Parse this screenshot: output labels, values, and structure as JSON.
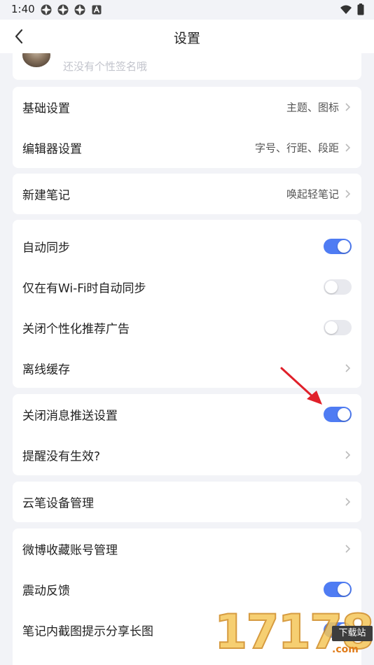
{
  "status": {
    "time": "1:40",
    "icons": [
      "app-icon",
      "app-icon",
      "app-icon",
      "a-icon"
    ],
    "right_icons": [
      "wifi-icon",
      "battery-icon"
    ]
  },
  "nav": {
    "title": "设置",
    "back_icon": "chevron-left-icon"
  },
  "profile": {
    "signature": "还没有个性签名哦"
  },
  "groups": {
    "basic": [
      {
        "label": "基础设置",
        "value": "主题、图标"
      },
      {
        "label": "编辑器设置",
        "value": "字号、行距、段距"
      }
    ],
    "new_note": [
      {
        "label": "新建笔记",
        "value": "唤起轻笔记"
      }
    ],
    "sync": [
      {
        "label": "自动同步",
        "toggle": true
      },
      {
        "label": "仅在有Wi-Fi时自动同步",
        "toggle": false
      },
      {
        "label": "关闭个性化推荐广告",
        "toggle": false
      },
      {
        "label": "离线缓存"
      }
    ],
    "push": [
      {
        "label": "关闭消息推送设置",
        "toggle": true
      },
      {
        "label": "提醒没有生效?"
      }
    ],
    "device": [
      {
        "label": "云笔设备管理"
      }
    ],
    "misc": [
      {
        "label": "微博收藏账号管理"
      },
      {
        "label": "震动反馈",
        "toggle": true
      },
      {
        "label": "笔记内截图提示分享长图",
        "toggle": true
      }
    ]
  },
  "watermark": {
    "digits": "17178",
    "badge": "下载站",
    "domain": ".com"
  },
  "colors": {
    "accent": "#4f7cf3",
    "background": "#f2f3f7",
    "annotation_arrow": "#e0202a"
  }
}
